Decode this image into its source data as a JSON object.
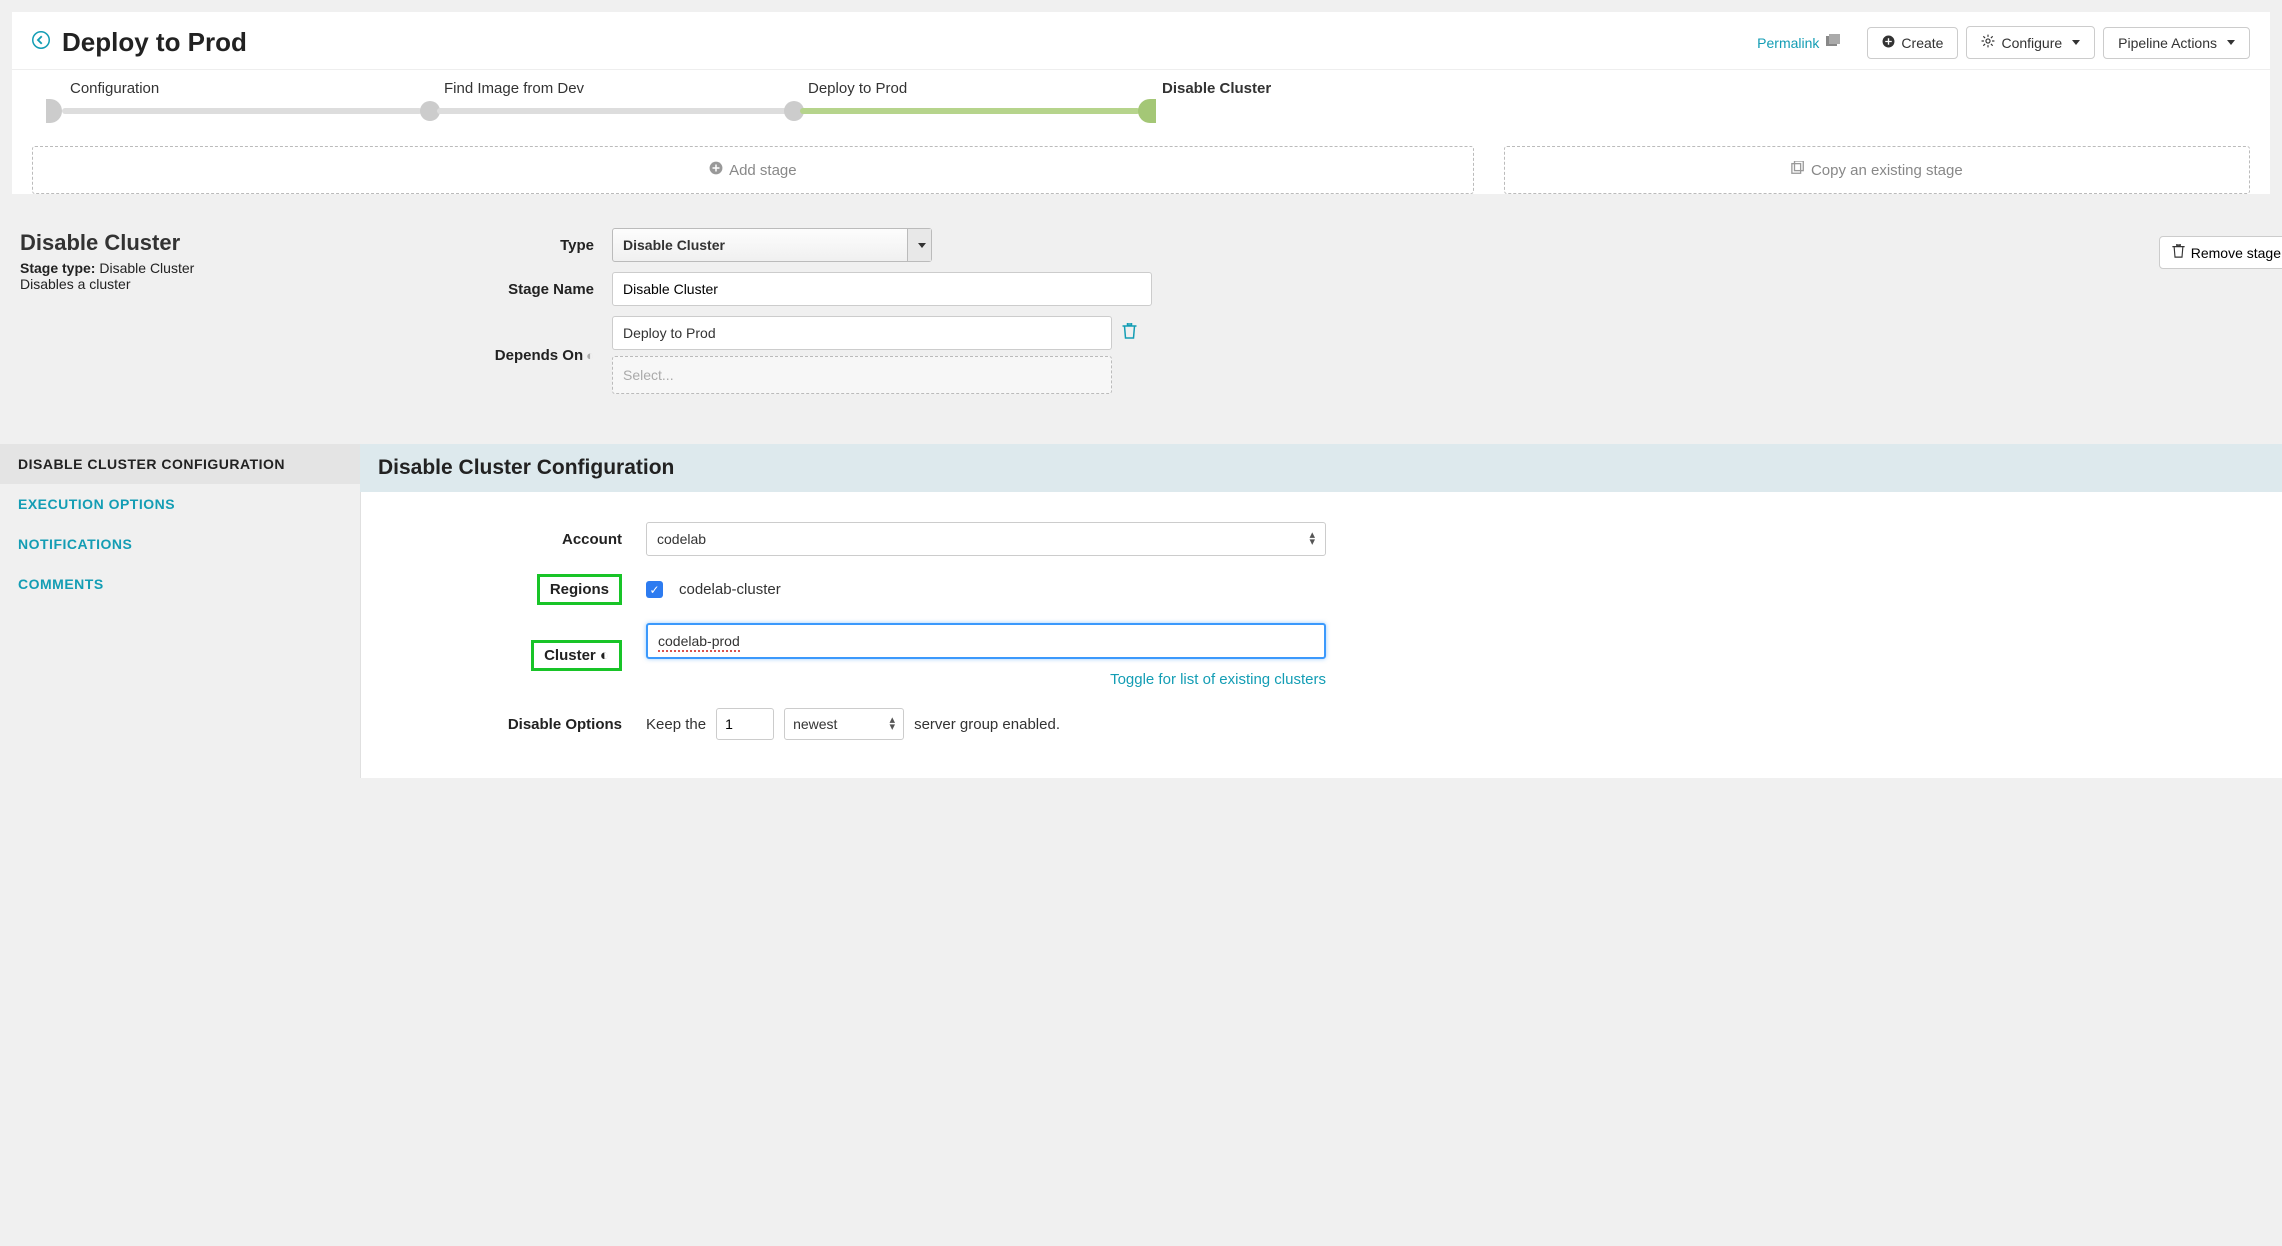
{
  "header": {
    "title": "Deploy to Prod",
    "permalink": "Permalink",
    "create": "Create",
    "configure": "Configure",
    "pipeline_actions": "Pipeline Actions"
  },
  "pipeline": {
    "stages": [
      "Configuration",
      "Find Image from Dev",
      "Deploy to Prod",
      "Disable Cluster"
    ],
    "add_stage": "Add stage",
    "copy_stage": "Copy an existing stage"
  },
  "stage_info": {
    "title": "Disable Cluster",
    "type_label": "Stage type:",
    "type_value": "Disable Cluster",
    "description": "Disables a cluster"
  },
  "stage_form": {
    "labels": {
      "type": "Type",
      "name": "Stage Name",
      "depends": "Depends On"
    },
    "type_value": "Disable Cluster",
    "name_value": "Disable Cluster",
    "depends_value": "Deploy to Prod",
    "select_placeholder": "Select...",
    "remove": "Remove stage"
  },
  "tabs": {
    "t1": "DISABLE CLUSTER CONFIGURATION",
    "t2": "EXECUTION OPTIONS",
    "t3": "NOTIFICATIONS",
    "t4": "COMMENTS"
  },
  "config": {
    "heading": "Disable Cluster Configuration",
    "labels": {
      "account": "Account",
      "regions": "Regions",
      "cluster": "Cluster",
      "disable_options": "Disable Options"
    },
    "account_value": "codelab",
    "region_value": "codelab-cluster",
    "cluster_value": "codelab-prod",
    "toggle_link": "Toggle for list of existing clusters",
    "disable_prefix": "Keep the",
    "disable_count": "1",
    "disable_order": "newest",
    "disable_suffix": "server group enabled."
  }
}
